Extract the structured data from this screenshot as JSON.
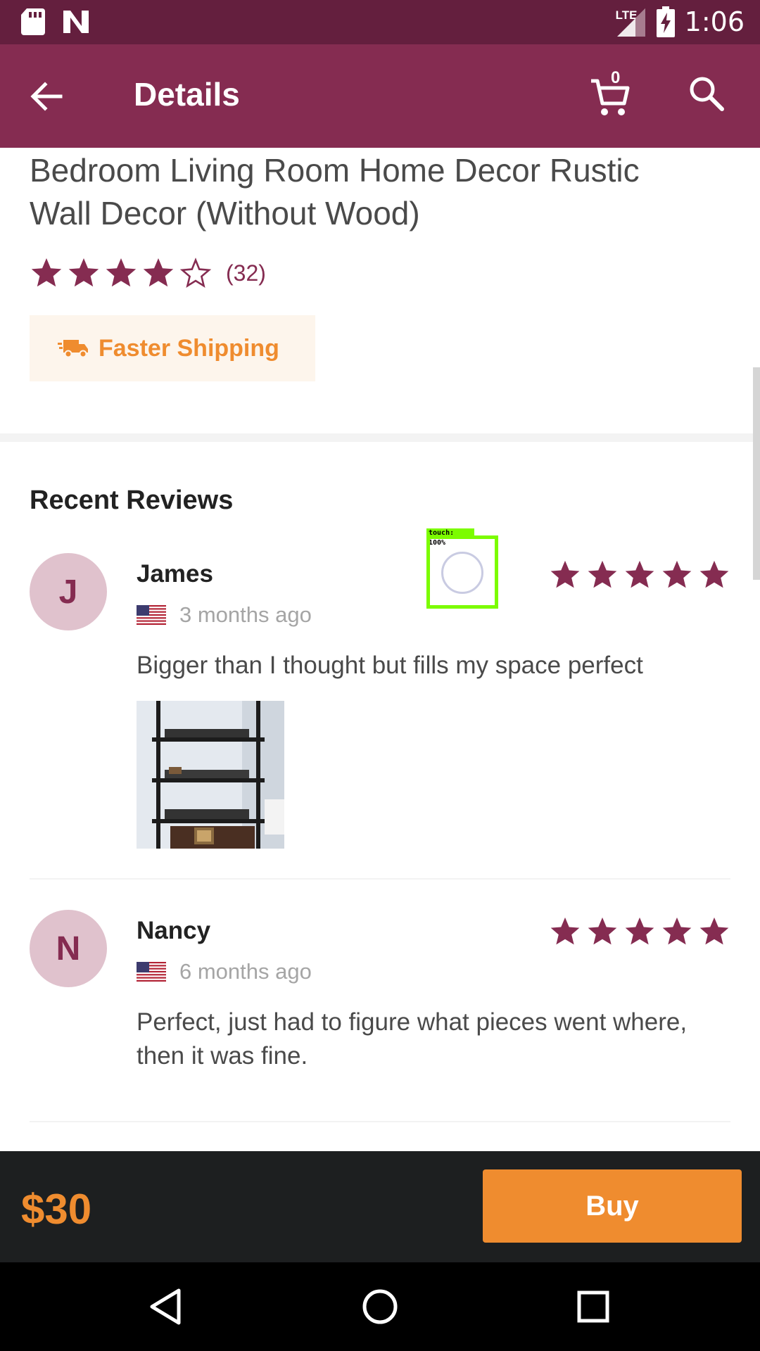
{
  "status_bar": {
    "time": "1:06",
    "network": "LTE",
    "icons": [
      "sd-card-icon",
      "n-notification-icon",
      "signal-icon",
      "battery-charging-icon"
    ]
  },
  "app_bar": {
    "title": "Details",
    "cart_count": "0",
    "icons": [
      "back-arrow-icon",
      "cart-icon",
      "search-icon"
    ]
  },
  "product": {
    "title": "Bedroom Living Room Home Decor Rustic Wall Decor (Without Wood)",
    "rating": 4,
    "rating_max": 5,
    "review_count": "(32)",
    "shipping_badge": "Faster Shipping"
  },
  "reviews": {
    "heading": "Recent Reviews",
    "items": [
      {
        "initial": "J",
        "name": "James",
        "country": "United States",
        "time": "3 months ago",
        "stars": 5,
        "text": "Bigger than I thought but fills my space perfect",
        "has_photo": true
      },
      {
        "initial": "N",
        "name": "Nancy",
        "country": "United States",
        "time": "6 months ago",
        "stars": 5,
        "text": "Perfect, just had to figure what pieces went where, then it was fine.",
        "has_photo": false
      }
    ]
  },
  "touch_overlay": {
    "label": "touch: 100%"
  },
  "purchase": {
    "price": "$30",
    "buy_label": "Buy"
  },
  "colors": {
    "status_bar": "#641f3e",
    "app_bar": "#852c51",
    "star": "#852c51",
    "accent_orange": "#ef8c2f",
    "buy_bar": "#1d1f20"
  },
  "nav": {
    "icons": [
      "nav-back-icon",
      "nav-home-icon",
      "nav-recents-icon"
    ]
  }
}
